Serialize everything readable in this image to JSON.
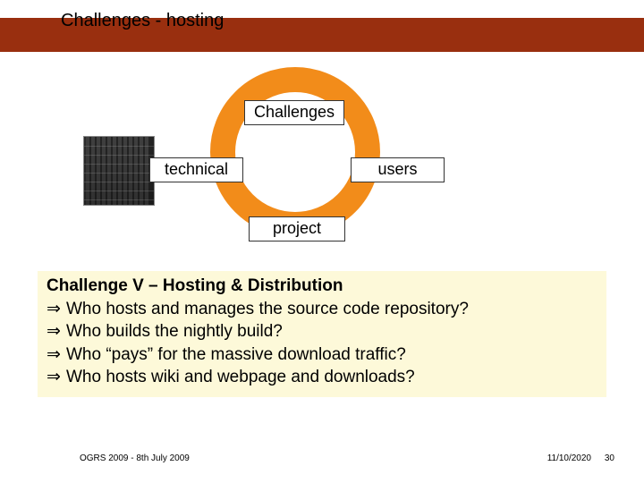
{
  "title": "Challenges - hosting",
  "ring_labels": {
    "top": "Challenges",
    "left": "technical",
    "right": "users",
    "bottom": "project"
  },
  "content": {
    "heading": "Challenge V – Hosting & Distribution",
    "bullets": [
      "Who hosts and manages the source code repository?",
      "Who builds the nightly build?",
      "Who “pays” for the massive download traffic?",
      "Who hosts wiki and webpage and downloads?"
    ]
  },
  "footer": {
    "left": "OGRS 2009 - 8th July 2009",
    "date": "11/10/2020",
    "page": "30"
  }
}
